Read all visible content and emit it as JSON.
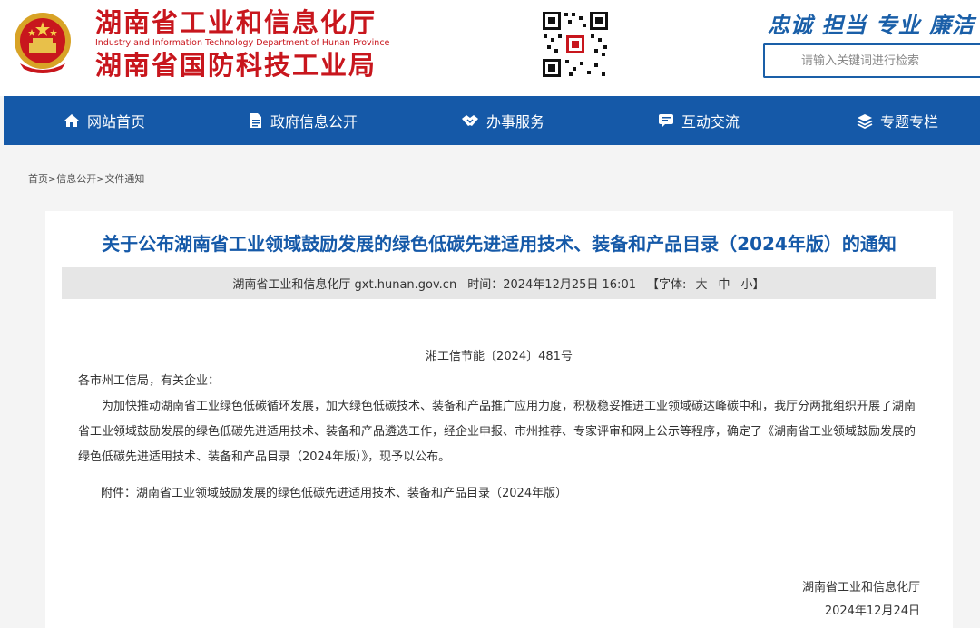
{
  "header": {
    "title_main": "湖南省工业和信息化厅",
    "title_en": "Industry and Information Technology Department of Hunan Province",
    "title_sub": "湖南省国防科技工业局",
    "slogan": "忠诚 担当 专业 廉洁",
    "search_placeholder": "请输入关键词进行检索",
    "emblem_icon": "national-emblem-icon",
    "qr_icon": "qr-code-icon"
  },
  "colors": {
    "brand_red": "#c8161d",
    "nav_blue": "#1559a8",
    "title_blue": "#1559a8"
  },
  "nav": {
    "items": [
      {
        "label": "网站首页",
        "icon": "home-icon"
      },
      {
        "label": "政府信息公开",
        "icon": "document-icon"
      },
      {
        "label": "办事服务",
        "icon": "handshake-icon"
      },
      {
        "label": "互动交流",
        "icon": "chat-icon"
      },
      {
        "label": "专题专栏",
        "icon": "layers-icon"
      }
    ]
  },
  "breadcrumb": {
    "items": [
      "首页",
      "信息公开",
      "文件通知"
    ],
    "separator": ">"
  },
  "article": {
    "title": "关于公布湖南省工业领域鼓励发展的绿色低碳先进适用技术、装备和产品目录（2024年版）的通知",
    "source": "湖南省工业和信息化厅 gxt.hunan.gov.cn",
    "time_label": "时间：",
    "time_value": "2024年12月25日 16:01",
    "font_label": "【字体:",
    "font_large": "大",
    "font_medium": "中",
    "font_small": "小】",
    "doc_number": "湘工信节能〔2024〕481号",
    "addressee": "各市州工信局，有关企业：",
    "paragraph": "为加快推动湖南省工业绿色低碳循环发展，加大绿色低碳技术、装备和产品推广应用力度，积极稳妥推进工业领域碳达峰碳中和，我厅分两批组织开展了湖南省工业领域鼓励发展的绿色低碳先进适用技术、装备和产品遴选工作，经企业申报、市州推荐、专家评审和网上公示等程序，确定了《湖南省工业领域鼓励发展的绿色低碳先进适用技术、装备和产品目录（2024年版）》，现予以公布。",
    "attachment": "附件：湖南省工业领域鼓励发展的绿色低碳先进适用技术、装备和产品目录（2024年版）",
    "sign_org": "湖南省工业和信息化厅",
    "sign_date": "2024年12月24日"
  }
}
